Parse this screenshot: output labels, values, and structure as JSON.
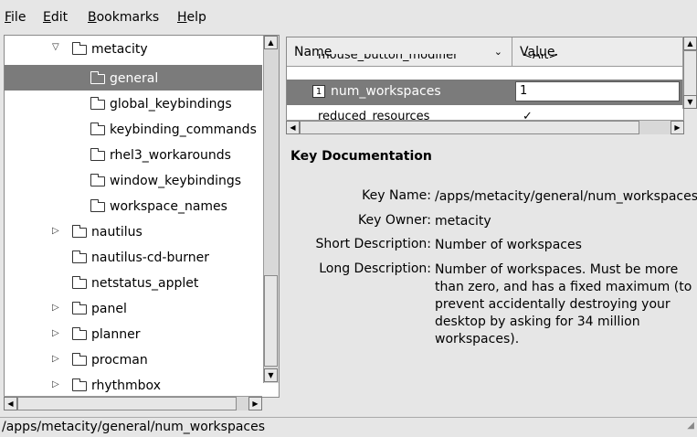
{
  "menubar": {
    "file": "File",
    "edit": "Edit",
    "bookmarks": "Bookmarks",
    "help": "Help"
  },
  "tree": {
    "items": [
      {
        "label": "metacity",
        "expanded": true
      },
      {
        "label": "general",
        "selected": true
      },
      {
        "label": "global_keybindings"
      },
      {
        "label": "keybinding_commands"
      },
      {
        "label": "rhel3_workarounds"
      },
      {
        "label": "window_keybindings"
      },
      {
        "label": "workspace_names"
      },
      {
        "label": "nautilus",
        "has_children": true
      },
      {
        "label": "nautilus-cd-burner"
      },
      {
        "label": "netstatus_applet"
      },
      {
        "label": "panel",
        "has_children": true
      },
      {
        "label": "planner",
        "has_children": true
      },
      {
        "label": "procman",
        "has_children": true
      },
      {
        "label": "rhythmbox",
        "has_children": true
      }
    ]
  },
  "list": {
    "col_name": "Name",
    "col_value": "Value",
    "rows": [
      {
        "name": "mouse_button_modifier",
        "value": "<Alt>"
      },
      {
        "name": "num_workspaces",
        "value": "1",
        "selected": true
      },
      {
        "name": "reduced_resources",
        "value": "✓"
      }
    ]
  },
  "doc": {
    "title": "Key Documentation",
    "key_name_label": "Key Name:",
    "key_name": "/apps/metacity/general/num_workspaces",
    "key_owner_label": "Key Owner:",
    "key_owner": "metacity",
    "short_desc_label": "Short Description:",
    "short_desc": "Number of workspaces",
    "long_desc_label": "Long Description:",
    "long_desc": "Number of workspaces. Must be more than zero, and has a fixed maximum (to prevent accidentally destroying your desktop by asking for 34 million workspaces)."
  },
  "status": {
    "path": "/apps/metacity/general/num_workspaces"
  }
}
